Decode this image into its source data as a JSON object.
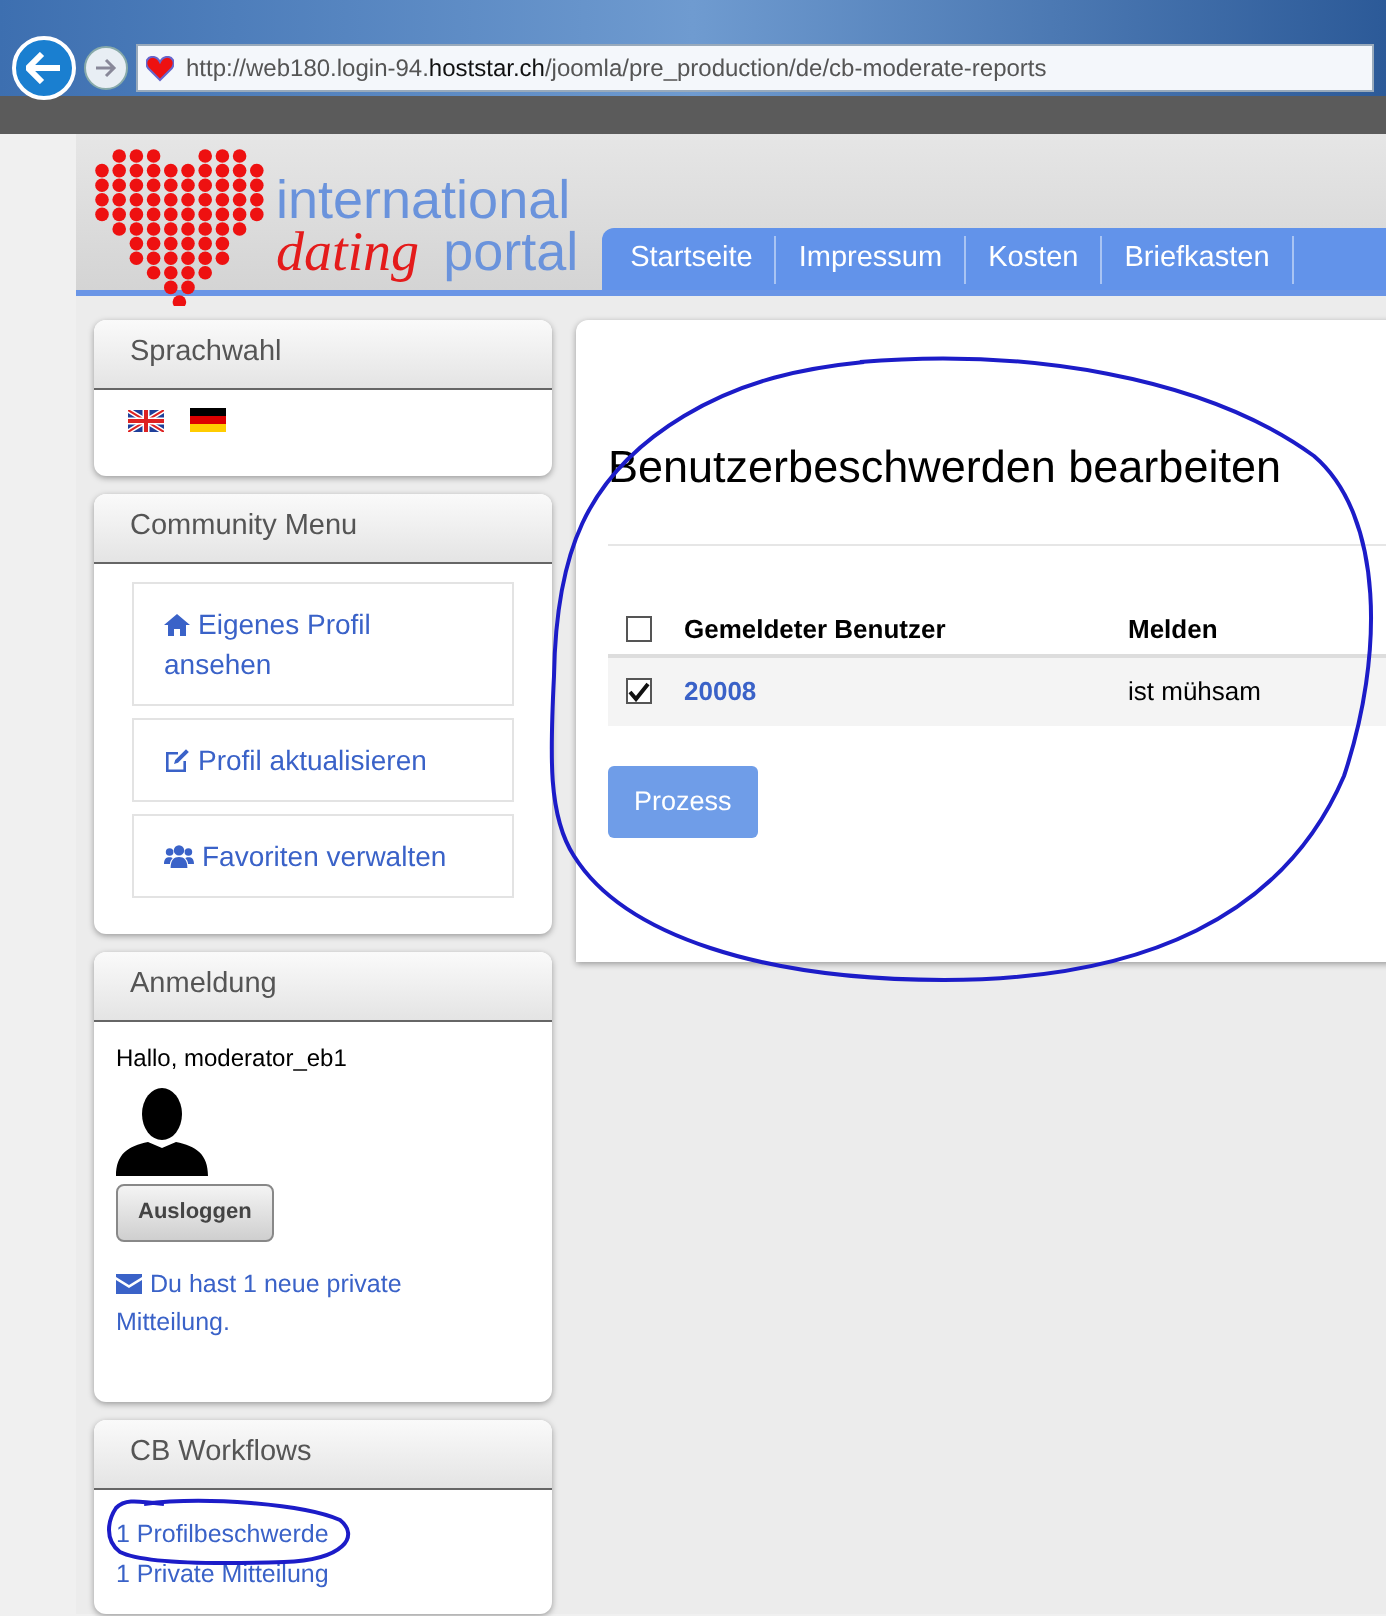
{
  "browser": {
    "url": "http://web180.login-94.**hoststar.ch**/joomla/pre_production/de/cb-moderate-reports"
  },
  "logo": {
    "line1": "international",
    "line2_a": "dating",
    "line2_b": "portal"
  },
  "nav": [
    {
      "label": "Startseite"
    },
    {
      "label": "Impressum"
    },
    {
      "label": "Kosten"
    },
    {
      "label": "Briefkasten"
    }
  ],
  "sidebar": [
    {
      "kind": "flags",
      "title": "Sprachwahl"
    },
    {
      "kind": "menu",
      "title": "Community Menu",
      "items": [
        {
          "label": "Eigenes Profil ansehen"
        },
        {
          "label": "Profil aktualisieren"
        },
        {
          "label": "Favoriten verwalten"
        }
      ]
    },
    {
      "kind": "login",
      "title": "Anmeldung",
      "greeting": "Hallo, moderator_eb1",
      "button": "Ausloggen",
      "message": "Du hast 1 neue private Mitteilung."
    },
    {
      "kind": "links",
      "title": "CB Workflows",
      "items": [
        {
          "label": "1 Profilbeschwerde"
        },
        {
          "label": "1 Private Mitteilung"
        }
      ]
    }
  ],
  "main": {
    "title": "Benutzerbeschwerden bearbeiten",
    "select_all": {
      "checked": false
    },
    "columns": [
      "Gemeldeter Benutzer",
      "Melden"
    ],
    "rows": [
      {
        "checked": true,
        "user": "20008",
        "report": "ist mühsam"
      }
    ],
    "button": "Prozess"
  }
}
